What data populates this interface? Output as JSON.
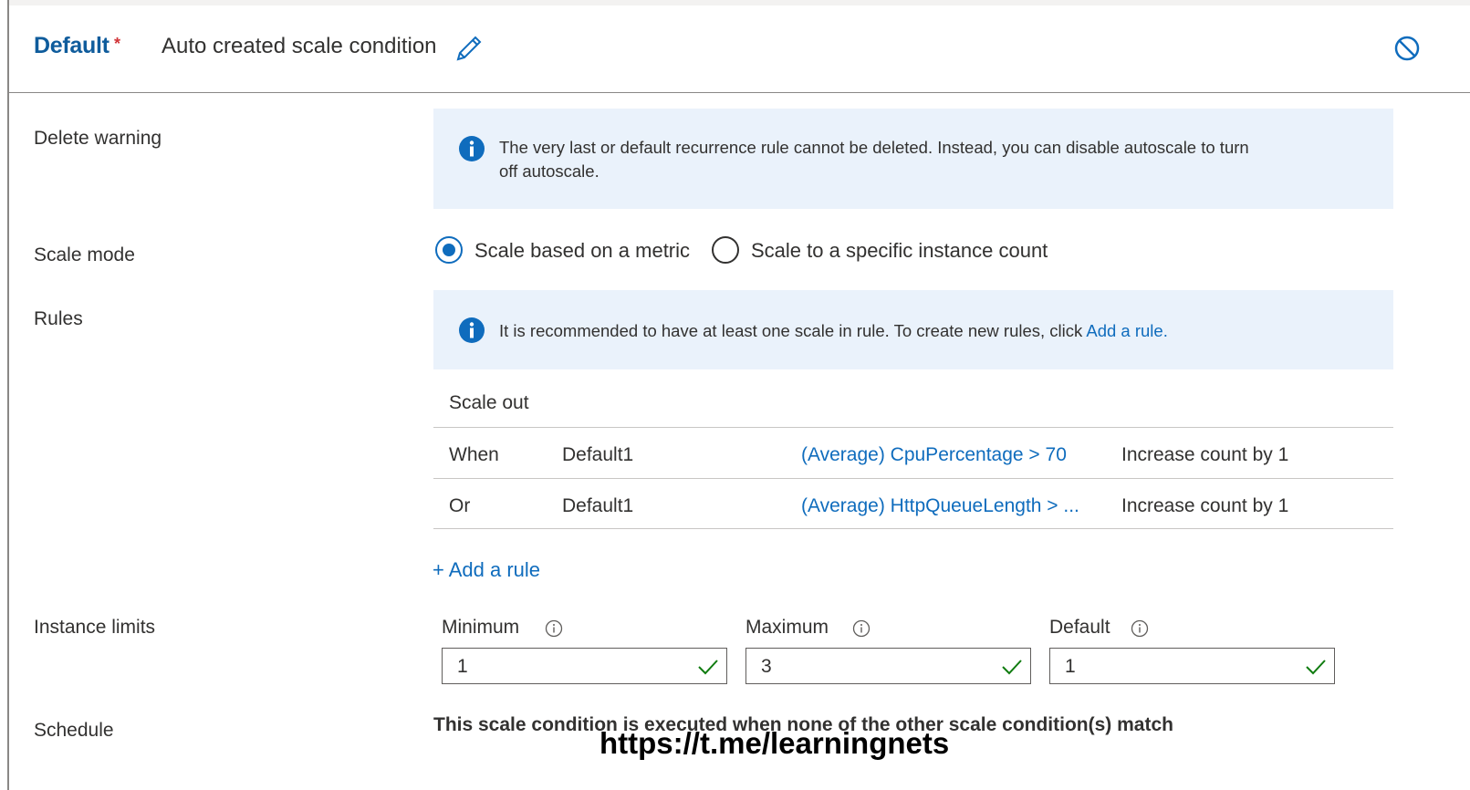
{
  "header": {
    "title": "Default",
    "required_marker": "*",
    "condition_name": "Auto created scale condition",
    "edit_icon": "pencil-icon",
    "disable_icon": "disable-icon"
  },
  "delete_warning": {
    "label": "Delete warning",
    "icon": "info-icon",
    "message_line1": "The very last or default recurrence rule cannot be deleted. Instead, you can disable autoscale to turn",
    "message_line2": "off autoscale."
  },
  "scale_mode": {
    "label": "Scale mode",
    "options": [
      {
        "label": "Scale based on a metric",
        "selected": true
      },
      {
        "label": "Scale to a specific instance count",
        "selected": false
      }
    ]
  },
  "rules": {
    "label": "Rules",
    "notice_text": "It is recommended to have at least one scale in rule. To create new rules, click ",
    "notice_link": "Add a rule.",
    "section_title": "Scale out",
    "rows": [
      {
        "keyword": "When",
        "resource": "Default1",
        "condition": "(Average) CpuPercentage > 70",
        "action": "Increase count by 1"
      },
      {
        "keyword": "Or",
        "resource": "Default1",
        "condition": "(Average) HttpQueueLength > ...",
        "action": "Increase count by 1"
      }
    ],
    "add_rule": "+ Add a rule"
  },
  "instance_limits": {
    "label": "Instance limits",
    "fields": [
      {
        "label": "Minimum",
        "value": "1"
      },
      {
        "label": "Maximum",
        "value": "3"
      },
      {
        "label": "Default",
        "value": "1"
      }
    ]
  },
  "schedule": {
    "label": "Schedule",
    "text": "This scale condition is executed when none of the other scale condition(s) match"
  },
  "watermark": "https://t.me/learningnets",
  "colors": {
    "brand_blue": "#0f5c9c",
    "link": "#0f6cbd",
    "info_bg": "#eaf2fb",
    "valid_check": "#107c10"
  }
}
